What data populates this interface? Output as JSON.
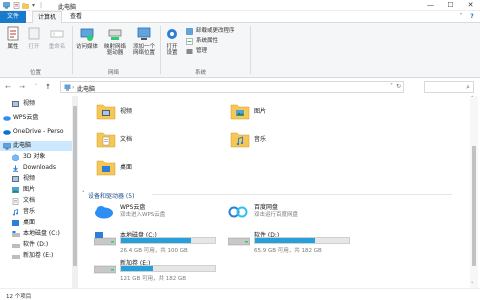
{
  "window": {
    "title": "此电脑",
    "controls": {
      "minimize": "—",
      "maximize": "☐",
      "close": "✕"
    }
  },
  "tabs": {
    "file": "文件",
    "computer": "计算机",
    "view": "查看"
  },
  "ribbon": {
    "location": {
      "label": "位置",
      "properties": "属性",
      "open": "打开",
      "rename": "重命名"
    },
    "network": {
      "label": "网络",
      "access_media": "访问媒体",
      "map_drive_line1": "映射网络",
      "map_drive_line2": "驱动器",
      "add_location_line1": "添加一个",
      "add_location_line2": "网络位置"
    },
    "system": {
      "label": "系统",
      "open_settings_line1": "打开",
      "open_settings_line2": "设置",
      "uninstall": "卸载或更改程序",
      "system_properties": "系统属性",
      "manage": "管理"
    }
  },
  "address": {
    "path": "此电脑",
    "separator": "›"
  },
  "nav": {
    "items": [
      {
        "label": "视频"
      },
      {
        "label": "WPS云盘"
      },
      {
        "label": "OneDrive - Perso"
      },
      {
        "label": "此电脑"
      },
      {
        "label": "3D 对象"
      },
      {
        "label": "Downloads"
      },
      {
        "label": "视频"
      },
      {
        "label": "图片"
      },
      {
        "label": "文档"
      },
      {
        "label": "音乐"
      },
      {
        "label": "桌面"
      },
      {
        "label": "本地磁盘 (C:)"
      },
      {
        "label": "软件 (D:)"
      },
      {
        "label": "新加卷 (E:)"
      }
    ]
  },
  "folders": [
    {
      "label": "视频"
    },
    {
      "label": "图片"
    },
    {
      "label": "文档"
    },
    {
      "label": "音乐"
    },
    {
      "label": "桌面"
    }
  ],
  "devices_section": {
    "label": "设备和驱动器 (5)"
  },
  "devices": {
    "wps": {
      "name": "WPS云盘",
      "sub": "双击进入WPS云盘"
    },
    "baidu": {
      "name": "百度网盘",
      "sub": "双击运行百度网盘"
    },
    "c": {
      "name": "本地磁盘 (C:)",
      "info": "26.4 GB 可用，共 100 GB",
      "used_fraction": 0.74
    },
    "d": {
      "name": "软件 (D:)",
      "info": "65.9 GB 可用，共 182 GB",
      "used_fraction": 0.64
    },
    "e": {
      "name": "新加卷 (E:)",
      "info": "121 GB 可用，共 182 GB",
      "used_fraction": 0.34
    }
  },
  "status": {
    "text": "12 个项目"
  },
  "colors": {
    "accent": "#1979ca",
    "bar_fill": "#26a0da",
    "folder": "#f6c755"
  }
}
